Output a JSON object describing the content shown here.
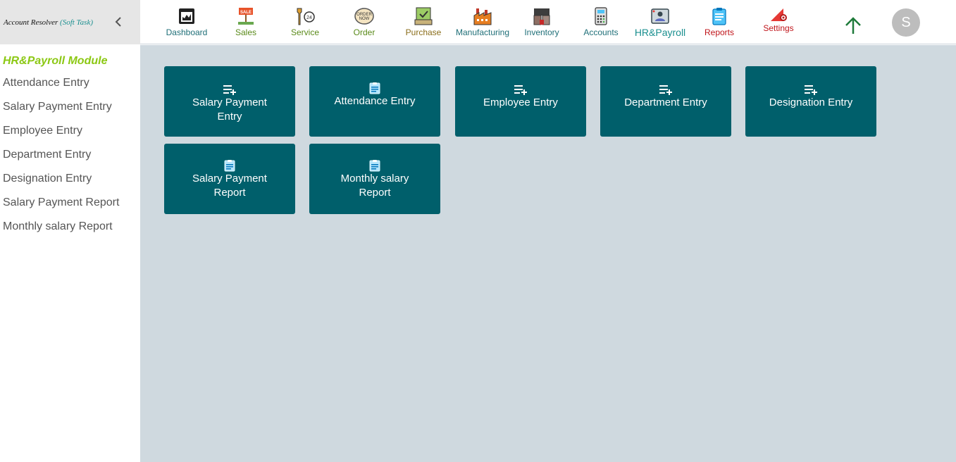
{
  "brand": {
    "name": "Account Resolver",
    "sub": "(Soft Task)"
  },
  "sidebar": {
    "module_title": "HR&Payroll Module",
    "items": [
      {
        "label": "Attendance Entry"
      },
      {
        "label": "Salary Payment Entry"
      },
      {
        "label": "Employee Entry"
      },
      {
        "label": "Department Entry"
      },
      {
        "label": "Designation Entry"
      },
      {
        "label": "Salary Payment Report"
      },
      {
        "label": "Monthly salary Report"
      }
    ]
  },
  "nav": {
    "items": [
      {
        "label": "Dashboard",
        "icon": "dashboard-icon",
        "color": "#1f6f78"
      },
      {
        "label": "Sales",
        "icon": "sale-sign-icon",
        "color": "#5a8a1a"
      },
      {
        "label": "Service",
        "icon": "wrench-24-icon",
        "color": "#5a8a1a"
      },
      {
        "label": "Order",
        "icon": "order-now-icon",
        "color": "#5a8a1a"
      },
      {
        "label": "Purchase",
        "icon": "in-stock-icon",
        "color": "#8a6d1a"
      },
      {
        "label": "Manufacturing",
        "icon": "factory-icon",
        "color": "#1f6f78"
      },
      {
        "label": "Inventory",
        "icon": "warehouse-icon",
        "color": "#1f6f78"
      },
      {
        "label": "Accounts",
        "icon": "calculator-icon",
        "color": "#1f6f78"
      },
      {
        "label": "HR&Payroll",
        "icon": "hr-board-icon",
        "color": "#1a8f8f"
      },
      {
        "label": "Reports",
        "icon": "clipboard-icon",
        "color": "#c0151b"
      },
      {
        "label": "Settings",
        "icon": "settings-triangle-icon",
        "color": "#c0151b"
      }
    ],
    "up_icon": "arrow-up-icon",
    "avatar_letter": "S"
  },
  "tiles": [
    {
      "label": "Salary Payment Entry",
      "icon": "playlist-add-icon"
    },
    {
      "label": "Attendance Entry",
      "icon": "clipboard-icon"
    },
    {
      "label": "Employee Entry",
      "icon": "playlist-add-icon"
    },
    {
      "label": "Department Entry",
      "icon": "playlist-add-icon"
    },
    {
      "label": "Designation Entry",
      "icon": "playlist-add-icon"
    },
    {
      "label": "Salary Payment Report",
      "icon": "clipboard-icon"
    },
    {
      "label": "Monthly salary Report",
      "icon": "clipboard-icon"
    }
  ],
  "colors": {
    "accent": "#005f6b",
    "module_title": "#8cc814",
    "content_bg": "#cfd9df",
    "up_arrow": "#1e7a3a"
  }
}
